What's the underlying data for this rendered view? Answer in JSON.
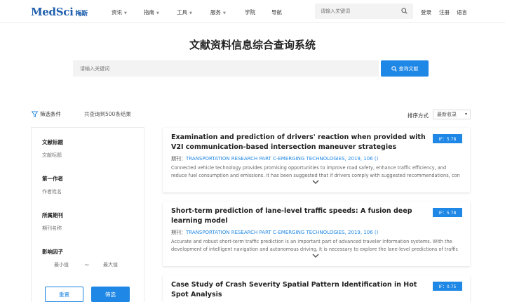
{
  "header": {
    "logo_text": "MedSci",
    "logo_cn": "梅斯",
    "nav": [
      {
        "label": "资讯",
        "has_dropdown": true
      },
      {
        "label": "指南",
        "has_dropdown": true
      },
      {
        "label": "工具",
        "has_dropdown": true
      },
      {
        "label": "服务",
        "has_dropdown": true
      },
      {
        "label": "学院",
        "has_dropdown": false
      },
      {
        "label": "导航",
        "has_dropdown": false
      }
    ],
    "search_placeholder": "请输入关键词",
    "login": "登录",
    "register": "注册",
    "language": "语言"
  },
  "page": {
    "title": "文献资料信息综合查询系统",
    "search_placeholder": "请输入关键词",
    "search_button": "查询文献"
  },
  "filter_bar": {
    "label": "筛选条件",
    "result_count": "共查询到500条结果",
    "sort_label": "排序方式",
    "sort_value": "最新收录"
  },
  "sidebar": {
    "title_label": "文献标题",
    "title_placeholder": "文献标题",
    "author_label": "第一作者",
    "author_placeholder": "作者姓名",
    "journal_label": "所属期刊",
    "journal_placeholder": "期刊名称",
    "if_label": "影响因子",
    "if_min_placeholder": "最小值",
    "if_max_placeholder": "最大值",
    "range_sep": "~",
    "reset_button": "重置",
    "filter_button": "筛选"
  },
  "results": [
    {
      "title": "Examination and prediction of drivers' reaction when provided with V2I communication-based intersection maneuver strategies",
      "if": "IF：5.78",
      "journal_label": "期刊：",
      "journal": "TRANSPORTATION RESEARCH PART C-EMERGING TECHNOLOGIES, 2019, 106 ()",
      "abstract": "Connected vehicle technology provides promising opportunities to improve road safety, enhance traffic efficiency, and reduce fuel consumption and emissions. It has been suggested that if drivers comply with suggested recommendations, con"
    },
    {
      "title": "Short-term prediction of lane-level traffic speeds: A fusion deep learning model",
      "if": "IF：5.78",
      "journal_label": "期刊：",
      "journal": "TRANSPORTATION RESEARCH PART C-EMERGING TECHNOLOGIES, 2019, 106 ()",
      "abstract": "Accurate and robust short-term traffic prediction is an important part of advanced traveler information systems. With the development of intelligent navigation and autonomous driving, it is necessary to explore the lane-level predictions of traffic"
    },
    {
      "title": "Case Study of Crash Severity Spatial Pattern Identification in Hot Spot Analysis",
      "if": "IF：0.75"
    }
  ],
  "colors": {
    "brand": "#1f5fae",
    "accent": "#1f87e5"
  }
}
